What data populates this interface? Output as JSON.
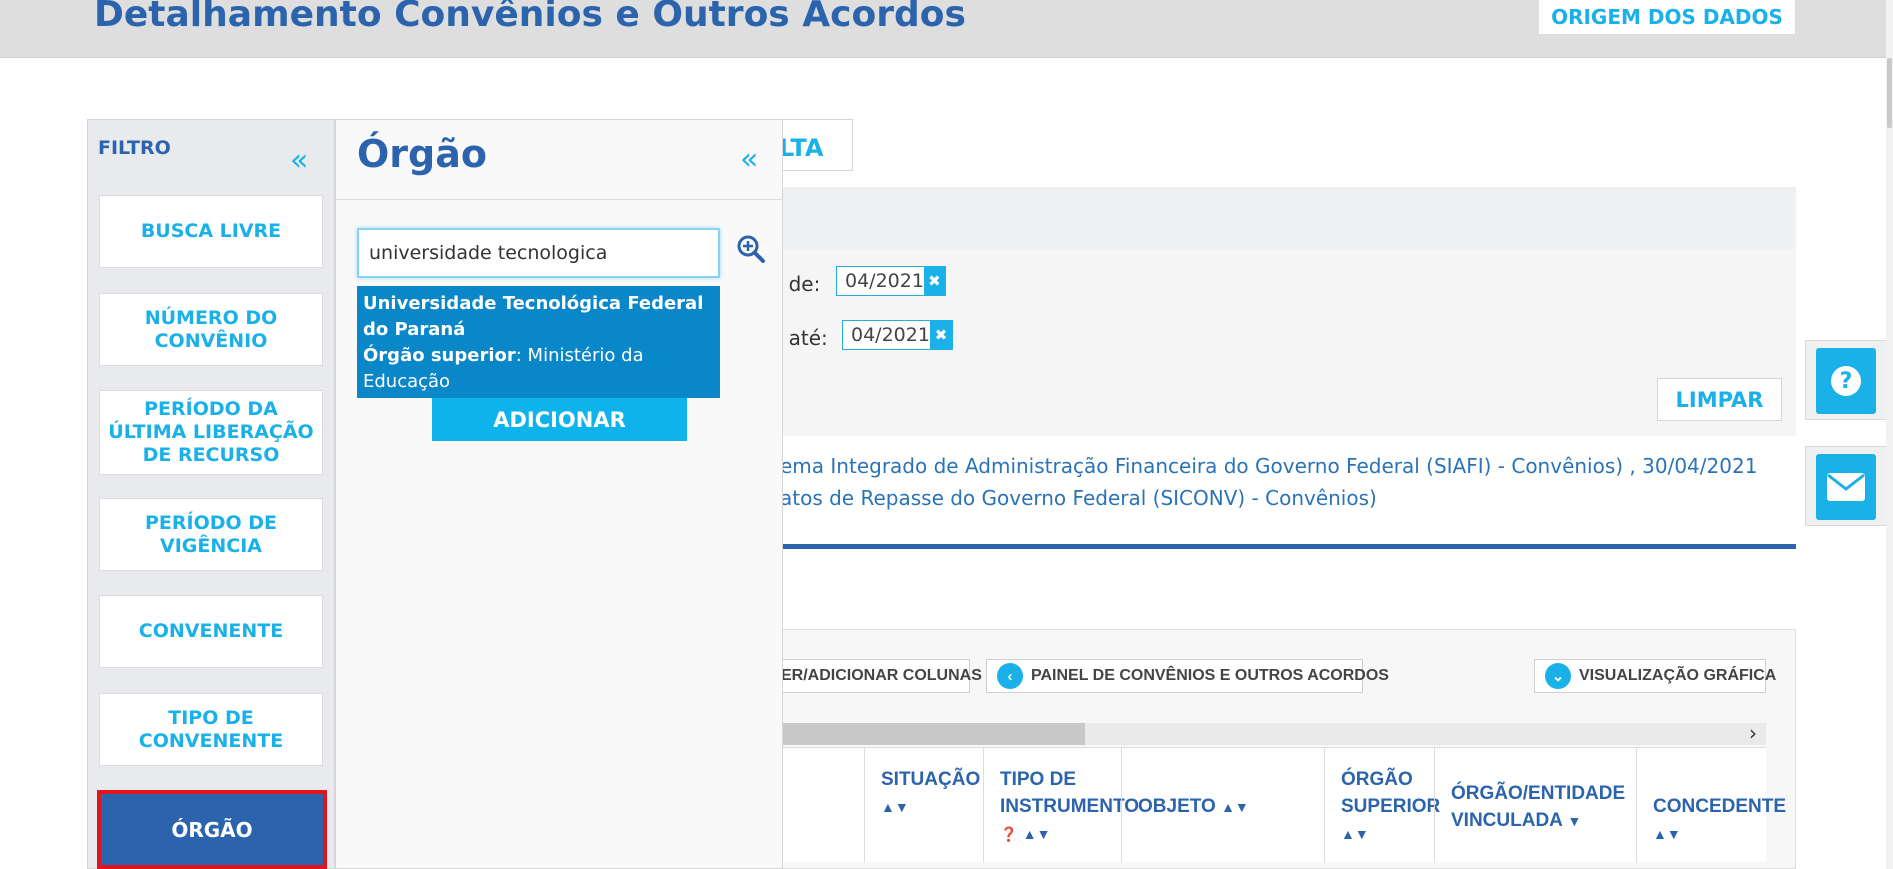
{
  "header": {
    "title": "Detalhamento Convênios e Outros Acordos",
    "origem_button": "ORIGEM DOS DADOS"
  },
  "background": {
    "consulta_tab_fragment": "LTA",
    "date_from_label": "o de:",
    "date_from_value": "04/2021",
    "date_to_label": "o até:",
    "date_to_value": "04/2021",
    "limpar_button": "LIMPAR",
    "source_line_1": "ema Integrado de Administração Financeira do Governo Federal (SIAFI) - Convênios) , 30/04/2021",
    "source_line_2": "atos de Repasse do Governo Federal (SICONV) - Convênios)",
    "toolbar": {
      "columns_button": "ER/ADICIONAR COLUNAS",
      "painel_button": "PAINEL DE CONVÊNIOS E OUTROS ACORDOS",
      "grafico_button": "VISUALIZAÇÃO GRÁFICA"
    },
    "table_headers": [
      {
        "line1": "SITUAÇÃO",
        "line2": ""
      },
      {
        "line1": "TIPO DE",
        "line2": "INSTRUMENTO"
      },
      {
        "line1": "OBJETO",
        "line2": ""
      },
      {
        "line1": "ÓRGÃO",
        "line2": "SUPERIOR"
      },
      {
        "line1": "ÓRGÃO/ENTIDADE",
        "line2": "VINCULADA"
      },
      {
        "line1": "CONCEDENTE",
        "line2": ""
      }
    ]
  },
  "sidebar": {
    "title": "FILTRO",
    "items": [
      {
        "label": "BUSCA LIVRE"
      },
      {
        "label": "NÚMERO DO CONVÊNIO"
      },
      {
        "label": "PERÍODO DA ÚLTIMA LIBERAÇÃO DE RECURSO"
      },
      {
        "label": "PERÍODO DE VIGÊNCIA"
      },
      {
        "label": "CONVENENTE"
      },
      {
        "label": "TIPO DE CONVENENTE"
      },
      {
        "label": "ÓRGÃO"
      }
    ]
  },
  "orgao_panel": {
    "title": "Órgão",
    "search_value": "universidade tecnologica",
    "suggestion": {
      "name": "Universidade Tecnológica Federal do Paraná",
      "superior_label": "Órgão superior",
      "superior_value": ": Ministério da Educação"
    },
    "add_button": "ADICIONAR"
  },
  "colors": {
    "primary_blue": "#2b63ad",
    "accent_cyan": "#1ab0e8",
    "suggestion_bg": "#0a87c8",
    "highlight_red": "#e0151c"
  }
}
